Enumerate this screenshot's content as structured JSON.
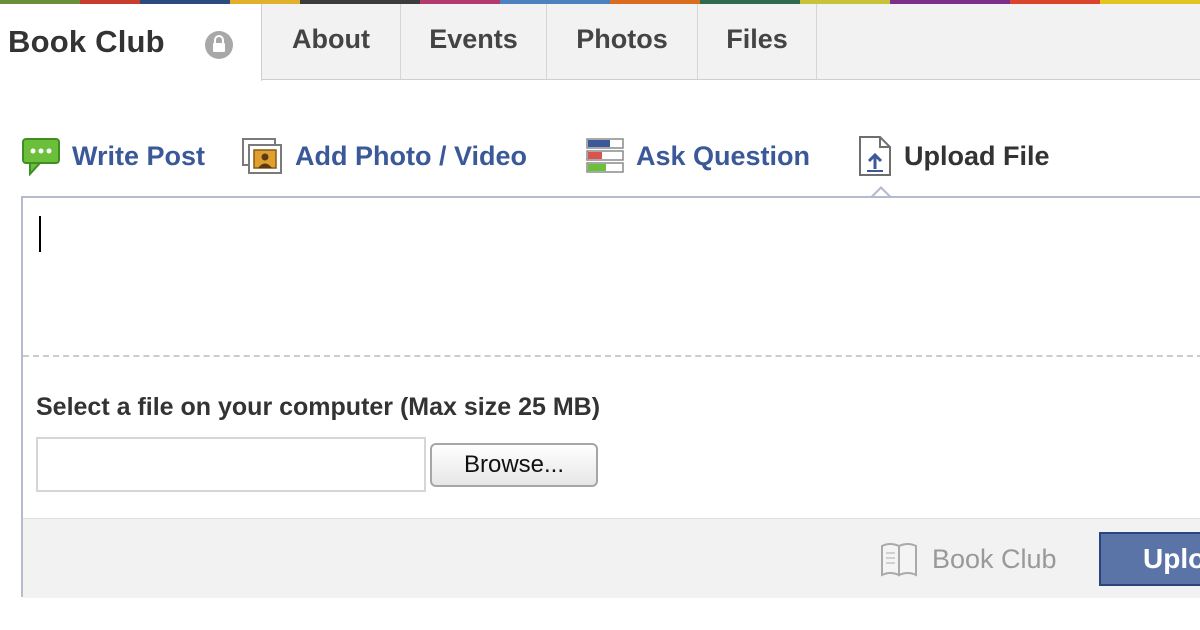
{
  "colors": {
    "link": "#3b5998",
    "header_bg": "#f2f2f2",
    "composer_border": "#b4bbcd",
    "primary_button": "#5b74a8"
  },
  "group": {
    "title": "Book Club",
    "privacy_icon": "lock-icon"
  },
  "tabs": [
    {
      "label": "About"
    },
    {
      "label": "Events"
    },
    {
      "label": "Photos"
    },
    {
      "label": "Files"
    }
  ],
  "composer": {
    "actions": [
      {
        "label": "Write Post",
        "icon": "speech-bubble-icon"
      },
      {
        "label": "Add Photo / Video",
        "icon": "photo-icon"
      },
      {
        "label": "Ask Question",
        "icon": "question-list-icon"
      },
      {
        "label": "Upload File",
        "icon": "file-upload-icon",
        "active": true
      }
    ],
    "text_value": "",
    "file_label": "Select a file on your computer (Max size 25 MB)",
    "file_path_value": "",
    "browse_label": "Browse...",
    "audience_label": "Book Club",
    "audience_icon": "book-icon",
    "submit_label": "Upload"
  }
}
